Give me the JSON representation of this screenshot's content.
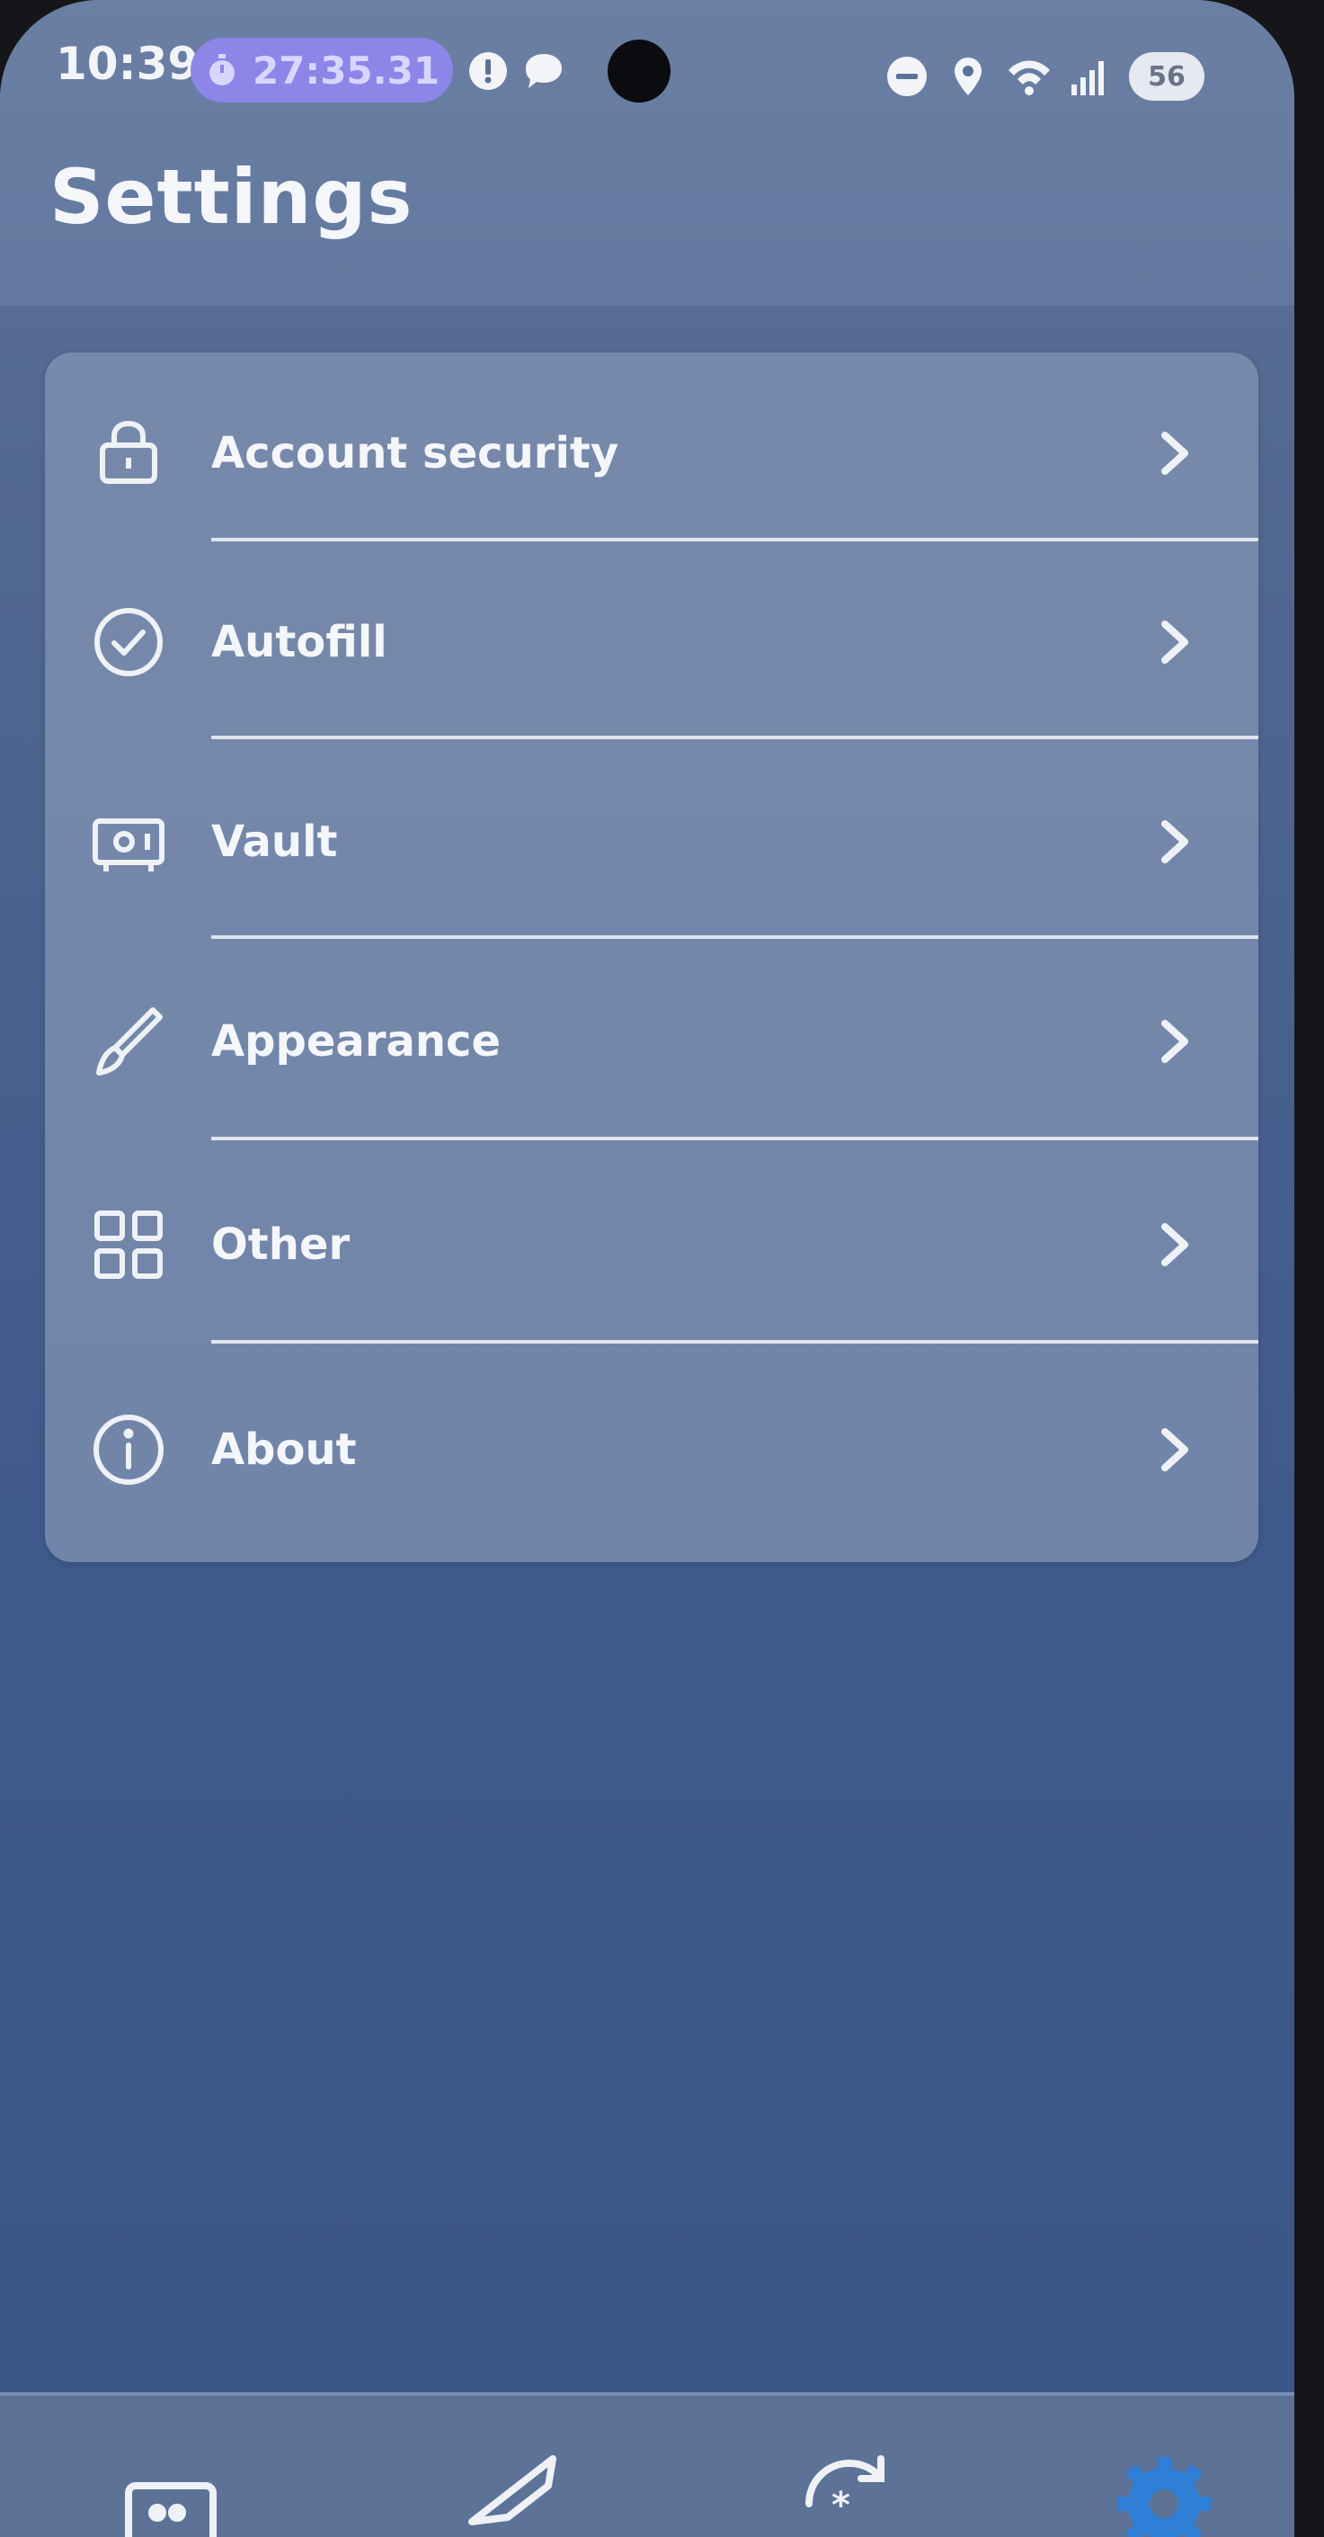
{
  "status_bar": {
    "time": "10:39",
    "timer": "27:35.31",
    "battery": "56",
    "notification_icons": [
      "alert-icon",
      "chat-bubble-icon"
    ],
    "system_icons": [
      "do-not-disturb-icon",
      "location-icon",
      "wifi-icon",
      "signal-icon"
    ]
  },
  "header": {
    "title": "Settings"
  },
  "settings": {
    "items": [
      {
        "label": "Account security",
        "icon": "lock-icon"
      },
      {
        "label": "Autofill",
        "icon": "check-circle-icon"
      },
      {
        "label": "Vault",
        "icon": "vault-icon"
      },
      {
        "label": "Appearance",
        "icon": "paintbrush-icon"
      },
      {
        "label": "Other",
        "icon": "grid-icon"
      },
      {
        "label": "About",
        "icon": "info-icon"
      }
    ]
  },
  "bottom_nav": {
    "items": [
      {
        "icon": "vault-tab-icon",
        "active": false
      },
      {
        "icon": "send-icon",
        "active": false
      },
      {
        "icon": "generator-icon",
        "active": false
      },
      {
        "icon": "settings-gear-icon",
        "active": true
      }
    ],
    "active_color": "#2f7fd6"
  },
  "colors": {
    "background": "#3f5a8c",
    "card": "#8496b4",
    "timer_chip": "#8b86e8",
    "text": "#f4f6fa"
  }
}
